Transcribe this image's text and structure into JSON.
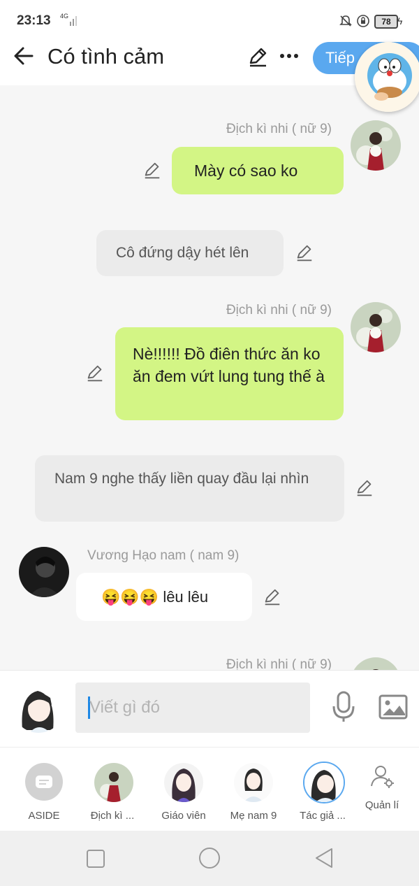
{
  "status_bar": {
    "time": "23:13",
    "network": "4G",
    "battery": "78"
  },
  "header": {
    "title": "Có tình cảm",
    "next_label": "Tiếp"
  },
  "messages": [
    {
      "sender": "Địch kì nhi ( nữ 9)",
      "text": "Mày có sao ko"
    },
    {
      "text": "Cô đứng dậy hét lên"
    },
    {
      "sender": "Địch kì nhi ( nữ 9)",
      "text": "Nè!!!!!!  Đồ điên thức ăn ko ăn đem vứt lung tung thế à"
    },
    {
      "text": "Nam 9 nghe thấy liền quay đầu lại nhìn"
    },
    {
      "sender": "Vương Hạo nam ( nam 9)",
      "emoji": "😝😝😝",
      "text": "lêu lêu"
    },
    {
      "sender": "Địch kì nhi ( nữ 9)"
    }
  ],
  "composer": {
    "placeholder": "Viết gì đó"
  },
  "characters": [
    {
      "label": "ASIDE"
    },
    {
      "label": "Địch kì ..."
    },
    {
      "label": "Giáo viên"
    },
    {
      "label": "Mẹ nam 9"
    },
    {
      "label": "Tác giả ..."
    },
    {
      "label": "Quản lí"
    }
  ],
  "colors": {
    "accent": "#5aa8ef",
    "bubble_green": "#d3f585",
    "bubble_gray": "#ebebeb"
  }
}
